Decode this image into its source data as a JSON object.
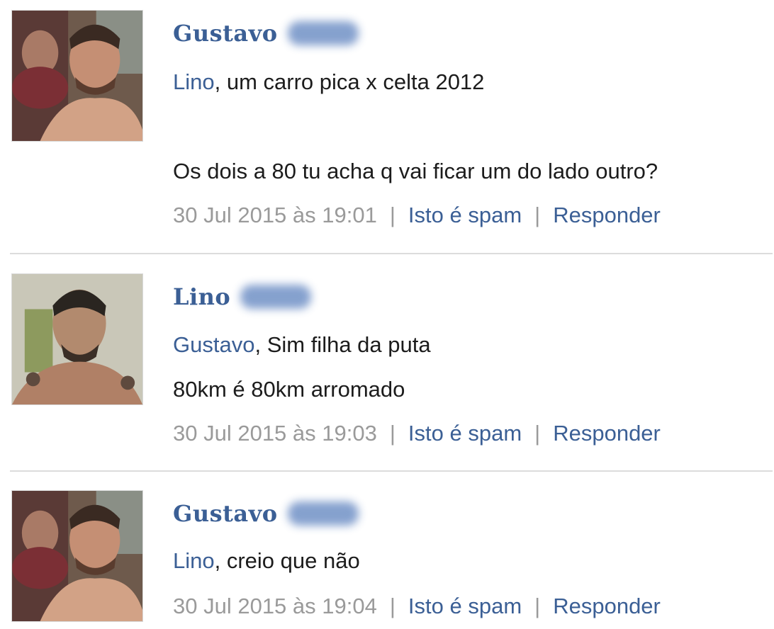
{
  "comments": [
    {
      "author": "Gustavo",
      "mention": "Lino",
      "lines": [
        "um carro pica x celta 2012",
        "Os dois a 80 tu acha q vai ficar um do lado outro?"
      ],
      "timestamp": "30 Jul 2015 às 19:01",
      "spam_label": "Isto é spam",
      "reply_label": "Responder",
      "separator": "|"
    },
    {
      "author": "Lino",
      "mention": "Gustavo",
      "lines": [
        "Sim filha da puta",
        "80km é 80km arromado"
      ],
      "timestamp": "30 Jul 2015 às 19:03",
      "spam_label": "Isto é spam",
      "reply_label": "Responder",
      "separator": "|"
    },
    {
      "author": "Gustavo",
      "mention": "Lino",
      "lines": [
        "creio que não"
      ],
      "timestamp": "30 Jul 2015 às 19:04",
      "spam_label": "Isto é spam",
      "reply_label": "Responder",
      "separator": "|"
    }
  ],
  "punctuation": {
    "comma": ", "
  },
  "colors": {
    "link": "#3b5f95",
    "meta": "#9a9a9a",
    "text": "#1c1c1c",
    "divider": "#dcdcdc"
  }
}
